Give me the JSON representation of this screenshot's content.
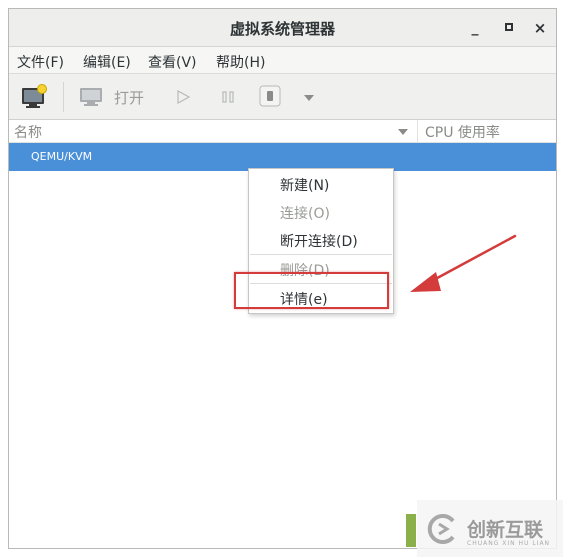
{
  "window": {
    "title": "虚拟系统管理器",
    "minimize_label": "_",
    "close_label": "×"
  },
  "menubar": {
    "items": [
      "文件(F)",
      "编辑(E)",
      "查看(V)",
      "帮助(H)"
    ]
  },
  "toolbar": {
    "open_label": "打开"
  },
  "columns": {
    "name": "名称",
    "cpu": "CPU 使用率"
  },
  "connections": [
    {
      "label": "QEMU/KVM",
      "selected": true
    }
  ],
  "context_menu": {
    "new": "新建(N)",
    "connect": "连接(O)",
    "disconnect": "断开连接(D)",
    "delete": "删除(D)",
    "details": "详情(e)"
  },
  "watermark": {
    "brand": "创新互联",
    "sub": "CHUANG XIN HU LIAN"
  },
  "colors": {
    "selection": "#4a90d9",
    "highlight": "#d43b3b",
    "disabled_text": "#9a9c98"
  }
}
